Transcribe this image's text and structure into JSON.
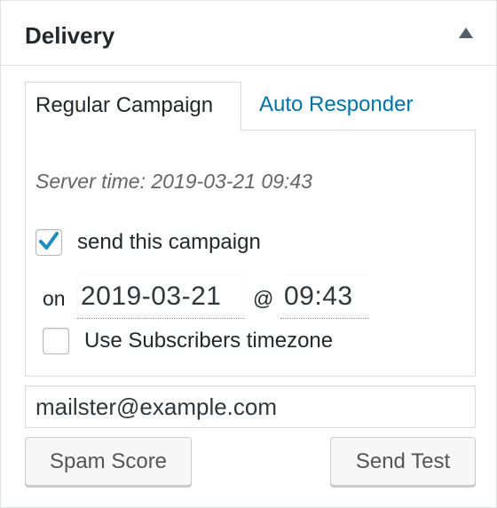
{
  "panel": {
    "title": "Delivery"
  },
  "tabs": [
    {
      "label": "Regular Campaign",
      "active": true
    },
    {
      "label": "Auto Responder",
      "active": false
    }
  ],
  "regular": {
    "server_time": "Server time: 2019-03-21 09:43",
    "send_checkbox_label": "send this campaign",
    "send_checked": true,
    "on_label": "on",
    "date_value": "2019-03-21",
    "at_label": "@",
    "time_value": "09:43",
    "timezone_label": "Use Subscribers timezone",
    "timezone_checked": false
  },
  "test": {
    "email_value": "mailster@example.com",
    "spam_score_label": "Spam Score",
    "send_test_label": "Send Test"
  },
  "colors": {
    "link": "#0073aa",
    "check": "#1e8cbe",
    "text": "#23282d",
    "muted": "#666666",
    "border": "#dcdcde"
  },
  "icons": {
    "collapse": "triangle-up-icon",
    "check": "checkmark-icon"
  }
}
